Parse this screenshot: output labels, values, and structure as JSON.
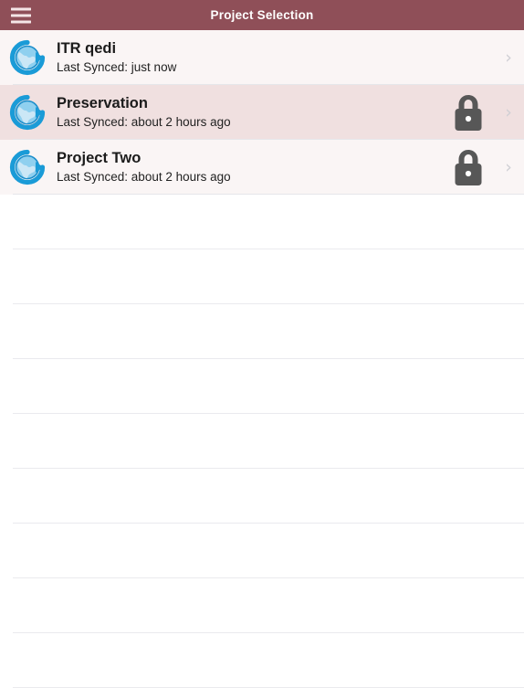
{
  "header": {
    "title": "Project Selection",
    "menu_icon": "hamburger-menu-icon",
    "background_color": "#8f4f58",
    "title_color": "#ffffff"
  },
  "list": {
    "chevron_glyph": "›",
    "lock_icon": "lock-icon",
    "logo_icon": "sync-globe-logo-icon",
    "row_colors": {
      "odd": "#faf5f5",
      "even": "#f0e0e0",
      "separator": "#e6e6ea"
    },
    "items": [
      {
        "title": "ITR qedi",
        "subtitle": "Last Synced: just now",
        "locked": false,
        "selected": false
      },
      {
        "title": "Preservation",
        "subtitle": "Last Synced: about 2 hours ago",
        "locked": true,
        "selected": true
      },
      {
        "title": "Project Two",
        "subtitle": "Last Synced: about 2 hours ago",
        "locked": true,
        "selected": false
      }
    ],
    "empty_row_count": 9
  }
}
